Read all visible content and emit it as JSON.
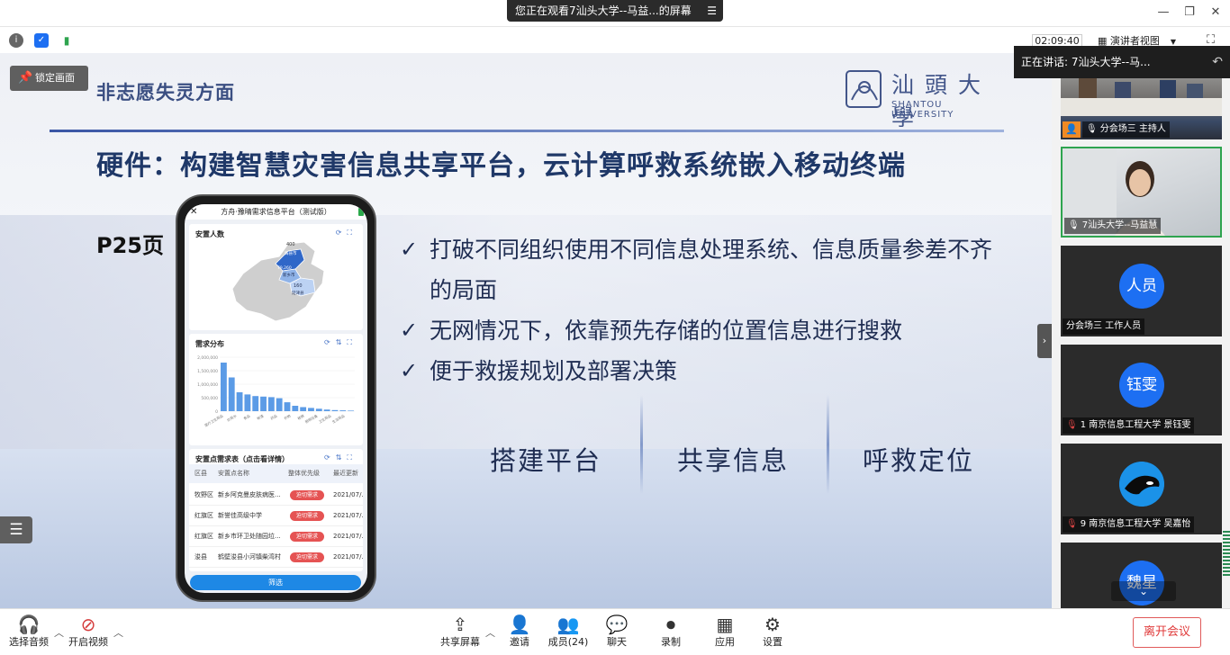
{
  "window": {
    "share_banner": "您正在观看7汕头大学--马益...的屏幕",
    "banner_menu": "☰"
  },
  "status": {
    "clock": "02:09:40",
    "view_mode": "演讲者视图"
  },
  "slide": {
    "lock_label": "锁定画面",
    "header": "非志愿失灵方面",
    "logo_cn": "汕頭大學",
    "logo_en": "SHANTOU UNIVERSITY",
    "title": "硬件：构建智慧灾害信息共享平台，云计算呼救系统嵌入移动终端",
    "page_ref": "P25页",
    "bullets": [
      "打破不同组织使用不同信息处理系统、信息质量参差不齐的局面",
      "无网情况下，依靠预先存储的位置信息进行搜救",
      "便于救援规划及部署决策"
    ],
    "pillars": [
      "搭建平台",
      "共享信息",
      "呼救定位"
    ]
  },
  "phone": {
    "app_title": "方舟·豫晴需求信息平台（测试版）",
    "map_card_title": "安置人数",
    "map_labels": [
      "400",
      "辉县市",
      "79,260",
      "新乡市",
      "160",
      "延津县",
      "卫辉市"
    ],
    "chart_card_title": "需求分布",
    "chart_data": {
      "type": "bar",
      "yticks": [
        "2,000,000",
        "1,500,000",
        "1,000,000",
        "500,000",
        "0"
      ],
      "values": [
        1800000,
        1250000,
        700000,
        620000,
        560000,
        540000,
        520000,
        480000,
        330000,
        200000,
        150000,
        120000,
        90000,
        60000,
        40000,
        30000,
        20000
      ],
      "ylim": [
        0,
        2000000
      ],
      "xlabels": [
        "医疗卫生用品",
        "饮用水",
        "食品",
        "帐篷",
        "药品",
        "衣物",
        "被褥",
        "照明设备",
        "卫生用品",
        "生活用品"
      ]
    },
    "table_card_title": "安置点需求表（点击看详情）",
    "table_headers": [
      "区县",
      "安置点名称",
      "整体优先级",
      "最近更新"
    ],
    "table_rows": [
      {
        "district": "牧野区",
        "name": "新乡阿克曼皮肤病医...",
        "priority": "迫切需求",
        "updated": "2021/07/..."
      },
      {
        "district": "红旗区",
        "name": "新誉佳高级中学",
        "priority": "迫切需求",
        "updated": "2021/07/..."
      },
      {
        "district": "红旗区",
        "name": "新乡市环卫处随园垃...",
        "priority": "迫切需求",
        "updated": "2021/07/..."
      },
      {
        "district": "浚县",
        "name": "鹤壁浚县小河镇柴湾村",
        "priority": "迫切需求",
        "updated": "2021/07/..."
      }
    ],
    "filter_label": "筛选"
  },
  "sidebar": {
    "speaking": "正在讲话: 7汕头大学--马...",
    "participants": [
      {
        "label": "分会场三 主持人",
        "type": "video"
      },
      {
        "label": "7汕头大学--马益慧",
        "type": "video"
      },
      {
        "label": "分会场三 工作人员",
        "avatar": "人员"
      },
      {
        "label": "1 南京信息工程大学 景钰雯",
        "avatar": "钰雯"
      },
      {
        "label": "9 南京信息工程大学 吴嘉怡",
        "avatar": "orca"
      },
      {
        "label": "",
        "avatar": "魏星"
      }
    ]
  },
  "toolbar": {
    "audio": "选择音频",
    "video": "开启视频",
    "share": "共享屏幕",
    "invite": "邀请",
    "members": "成员(24)",
    "chat": "聊天",
    "record": "录制",
    "apps": "应用",
    "settings": "设置",
    "leave": "离开会议"
  },
  "colors": {
    "accent_blue": "#1d6ff2",
    "title_navy": "#1f3868",
    "leave_red": "#e03a3a",
    "active_green": "#2ea44f"
  }
}
